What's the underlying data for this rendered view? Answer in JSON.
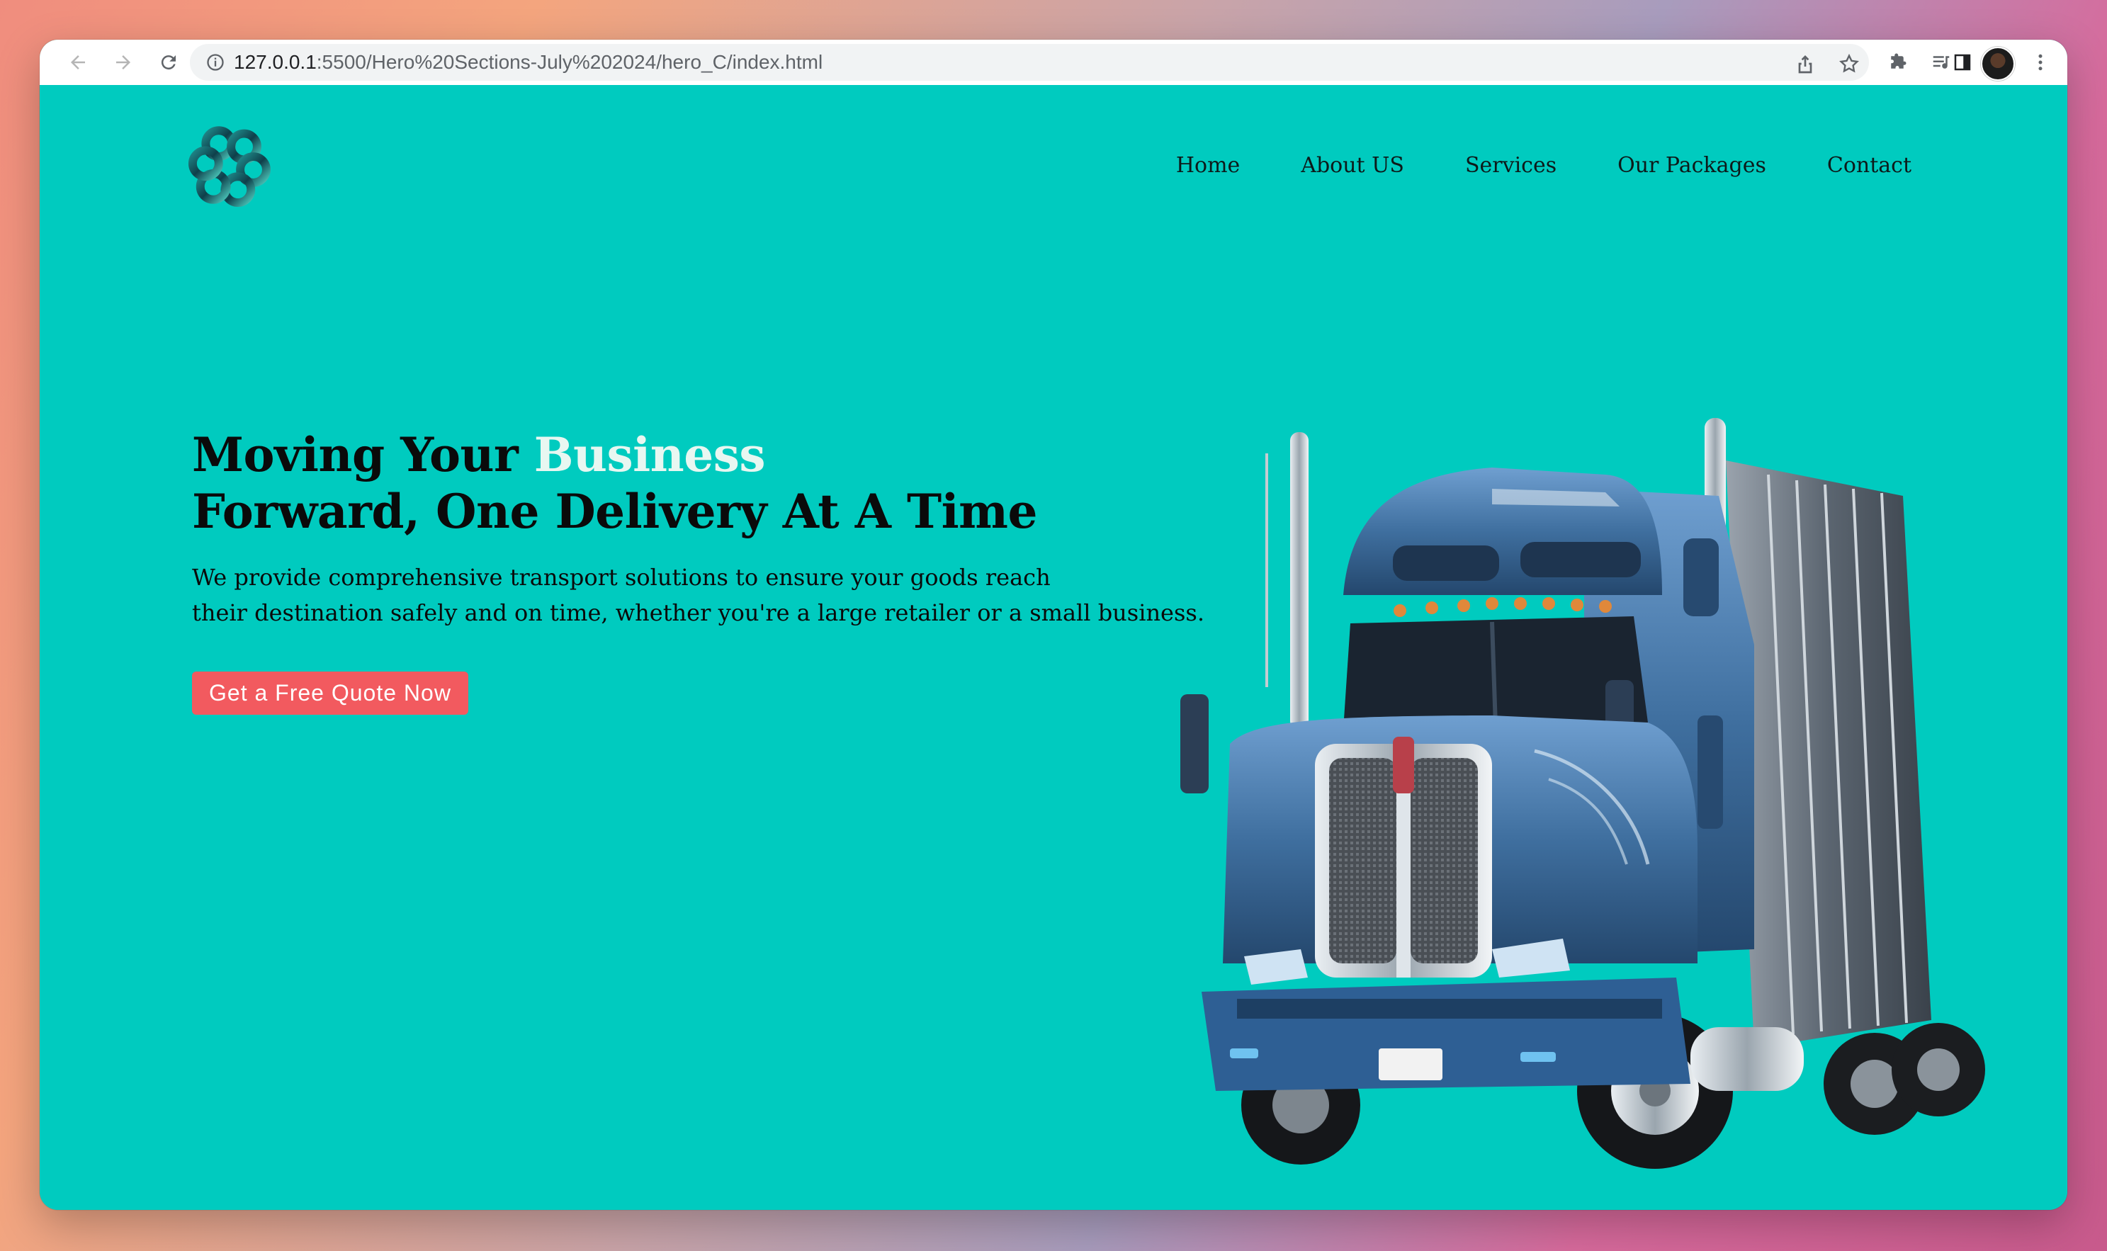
{
  "browser": {
    "url_host": "127.0.0.1",
    "url_path": ":5500/Hero%20Sections-July%202024/hero_C/index.html",
    "icons": [
      "back-arrow-icon",
      "forward-arrow-icon",
      "reload-icon",
      "info-icon",
      "share-icon",
      "star-icon",
      "extensions-icon",
      "media-icon",
      "side-panel-icon",
      "menu-icon"
    ]
  },
  "nav": {
    "items": [
      {
        "label": "Home"
      },
      {
        "label": "About US"
      },
      {
        "label": "Services"
      },
      {
        "label": "Our Packages"
      },
      {
        "label": "Contact"
      }
    ]
  },
  "hero": {
    "headline_part1": "Moving Your ",
    "headline_accent": "Business",
    "headline_part2": "Forward, One Delivery At A Time",
    "sub_line1": "We provide comprehensive transport solutions to ensure your goods reach",
    "sub_line2": "their destination safely and on time, whether you're a large retailer or a small business.",
    "cta_label": "Get a Free Quote Now"
  },
  "colors": {
    "background": "#00cbbf",
    "accent_text": "#e8f7f1",
    "cta": "#f25a5f"
  }
}
